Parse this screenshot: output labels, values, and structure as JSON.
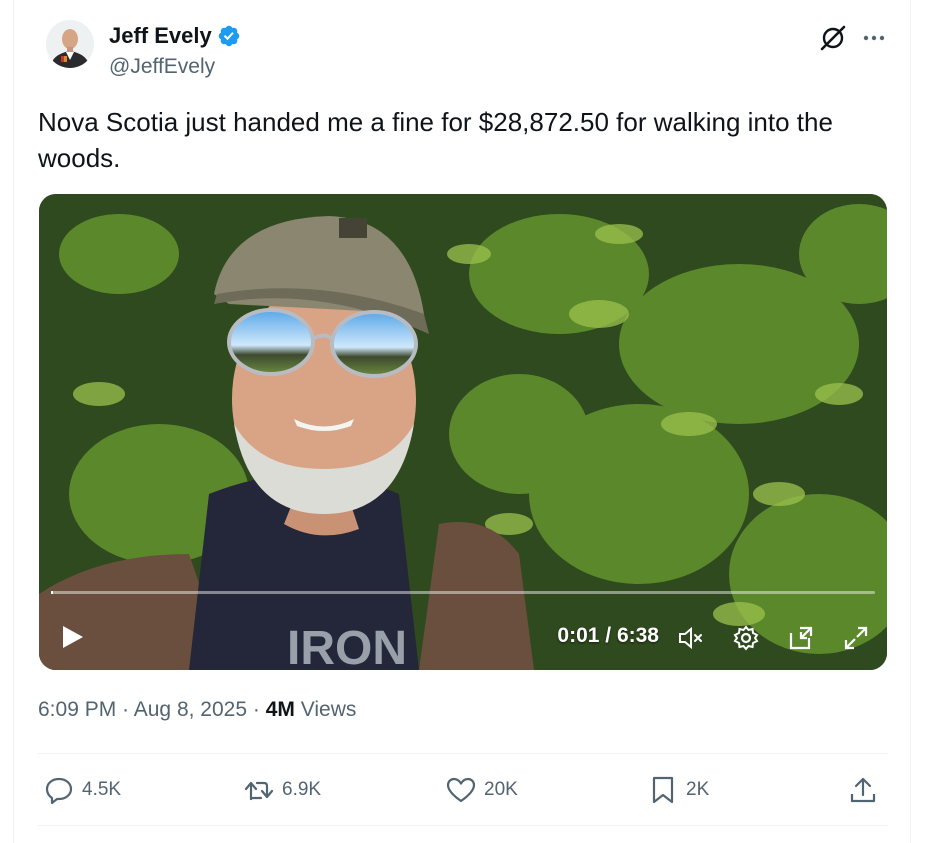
{
  "author": {
    "name": "Jeff Evely",
    "handle": "@JeffEvely"
  },
  "tweet": {
    "text": "Nova Scotia just handed me a fine for $28,872.50 for walking into the woods."
  },
  "video": {
    "time_display": "0:01 / 6:38",
    "progress": 0.003
  },
  "meta": {
    "time": "6:09 PM",
    "separator": "·",
    "date": "Aug 8, 2025",
    "views_count": "4M",
    "views_label": "Views"
  },
  "actions": {
    "replies": "4.5K",
    "reposts": "6.9K",
    "likes": "20K",
    "bookmarks": "2K"
  },
  "colors": {
    "verified": "#1d9bf0",
    "secondary_text": "#536471"
  }
}
